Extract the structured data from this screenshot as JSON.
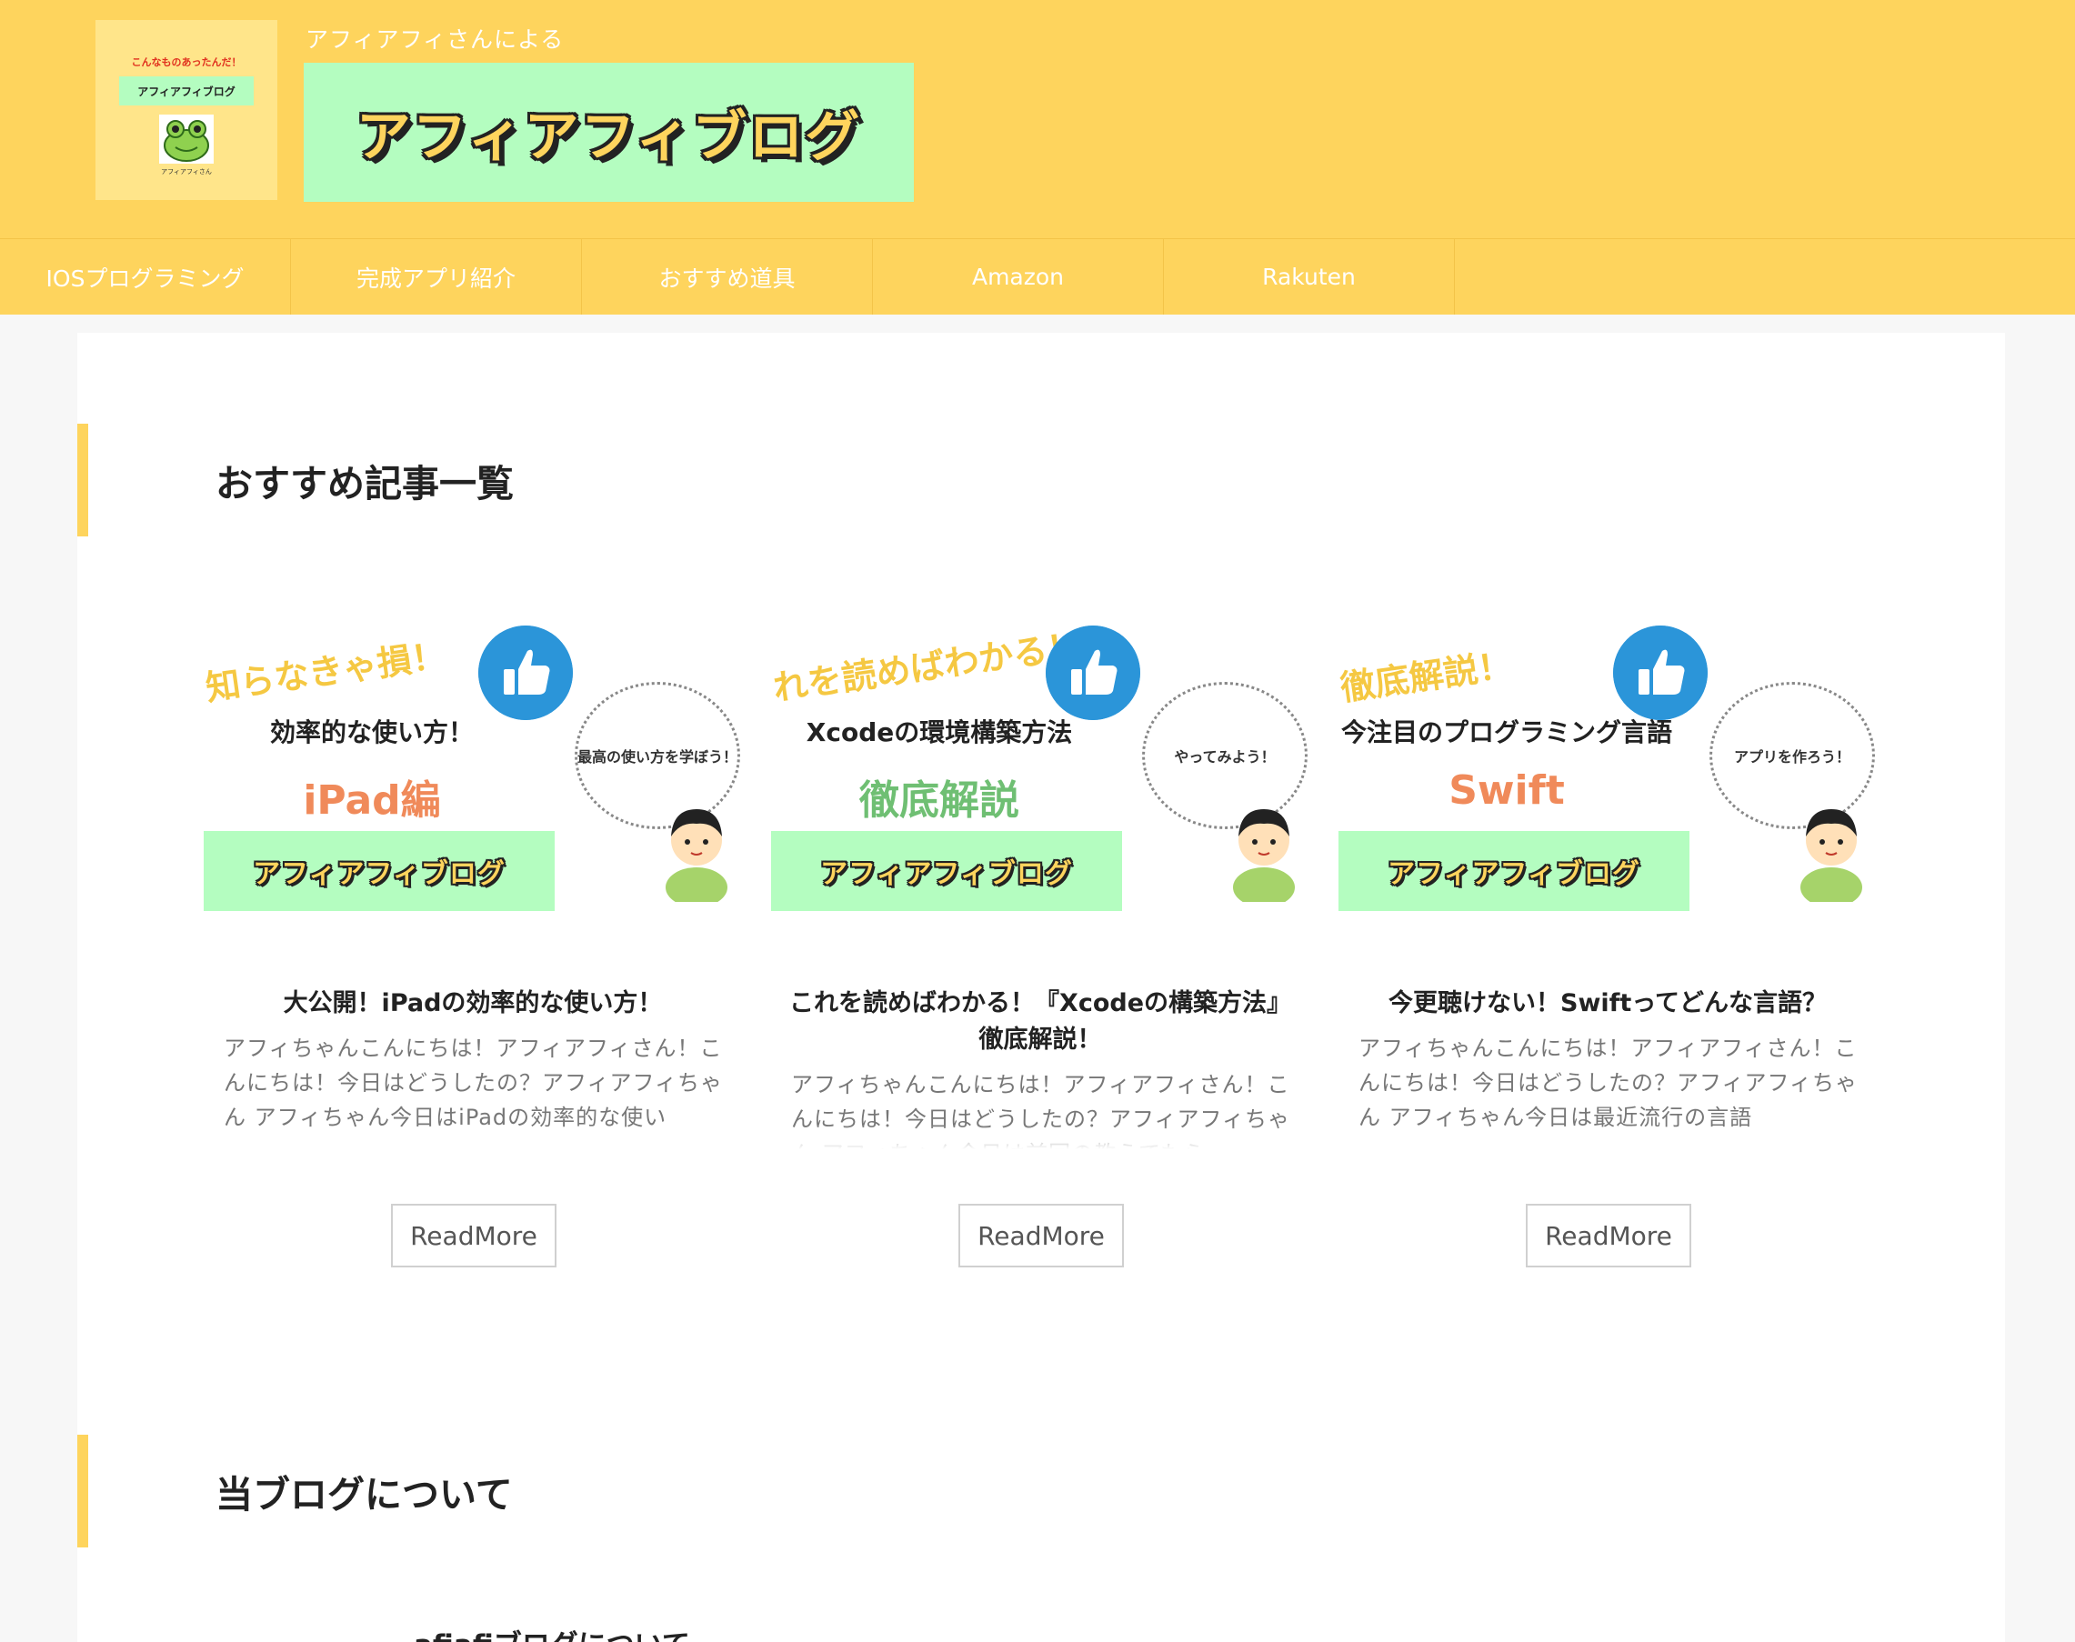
{
  "header": {
    "byline": "アフィアフィさんによる",
    "title": "アフィアフィブログ",
    "logo": {
      "tagline": "こんなものあったんだ！",
      "blog_name": "アフィアフィブログ",
      "owner": "アフィアフィさん"
    }
  },
  "nav": {
    "items": [
      {
        "label": "IOSプログラミング"
      },
      {
        "label": "完成アプリ紹介"
      },
      {
        "label": "おすすめ道具"
      },
      {
        "label": "Amazon"
      },
      {
        "label": "Rakuten"
      }
    ]
  },
  "recommended": {
    "heading": "おすすめ記事一覧",
    "readmore_label": "ReadMore",
    "cards": [
      {
        "thumb_catch": "知らなきゃ損！",
        "thumb_line1": "効率的な使い方！",
        "thumb_line2": "iPad編",
        "thumb_line2_color": "#f08a5a",
        "thumb_bubble": "最高の使い方を学ぼう！",
        "thumb_band": "アフィアフィブログ",
        "title": "大公開！iPadの効率的な使い方！",
        "excerpt": "アフィちゃんこんにちは！アフィアフィさん！こんにちは！今日はどうしたの？アフィアフィちゃん アフィちゃん今日はiPadの効率的な使い"
      },
      {
        "thumb_catch": "れを読めばわかる！",
        "thumb_line1": "Xcodeの環境構築方法",
        "thumb_line2": "徹底解説",
        "thumb_line2_color": "#6fbf73",
        "thumb_bubble": "やってみよう！",
        "thumb_band": "アフィアフィブログ",
        "title": "これを読めばわかる！『Xcodeの構築方法』徹底解説！",
        "excerpt": "アフィちゃんこんにちは！アフィアフィさん！こんにちは！今日はどうしたの？アフィアフィちゃん アフィちゃん今日は前回の教えてもらっ"
      },
      {
        "thumb_catch": "徹底解説！",
        "thumb_line1": "今注目のプログラミング言語",
        "thumb_line2": "Swift",
        "thumb_line2_color": "#f08a5a",
        "thumb_bubble": "アプリを作ろう！",
        "thumb_band": "アフィアフィブログ",
        "title": "今更聴けない！Swiftってどんな言語？",
        "excerpt": "アフィちゃんこんにちは！アフィアフィさん！こんにちは！今日はどうしたの？アフィアフィちゃん アフィちゃん今日は最近流行の言語"
      }
    ]
  },
  "about": {
    "heading": "当ブログについて",
    "item_title": "afiafiブログについて"
  },
  "colors": {
    "header_bg": "#fed45d",
    "banner_bg": "#b4fdc0",
    "like_button": "#2b95d9"
  },
  "icons": [
    "frog-mascot-icon",
    "thumbs-up-icon",
    "person-illustration-icon"
  ]
}
